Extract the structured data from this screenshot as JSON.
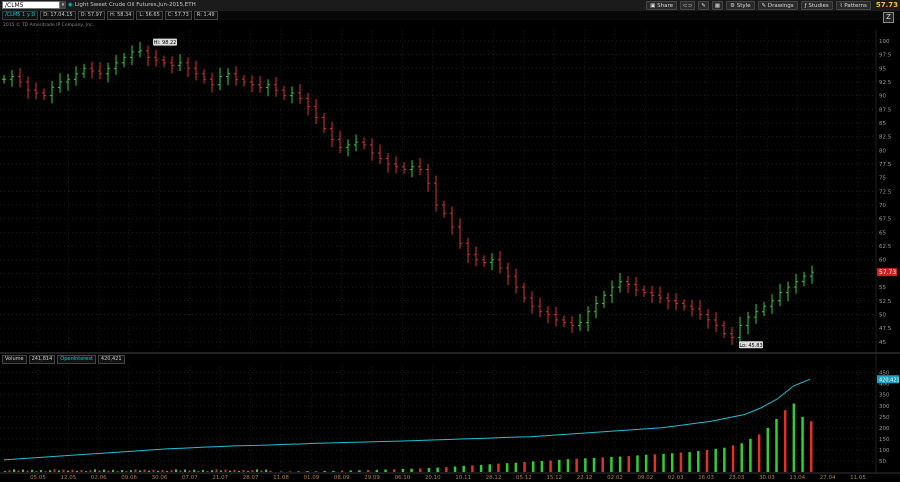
{
  "toolbar": {
    "symbol": "/CLM5",
    "description": "Light Sweet Crude Oil Futures,Jun-2015,ETH",
    "buttons": [
      "Share",
      "Style",
      "Drawings",
      "Studies",
      "Patterns"
    ],
    "last_price": "57.73"
  },
  "info_bar": {
    "symbol_period": "/CLM5 1 y D",
    "date": "D: 17.04.15",
    "open": "O: 57.97",
    "high": "H: 58.34",
    "low": "L: 56.65",
    "close": "C: 57.73",
    "change": "R: 1.49"
  },
  "copyright": "2015 © TD Ameritrade IP Company, Inc.",
  "volume_header": {
    "label": "Volume",
    "volume_value": "241,814",
    "oi_label": "OpenInterest",
    "oi_value": "420,421"
  },
  "chart_data": [
    {
      "type": "candlestick",
      "title": "Light Sweet Crude Oil Futures,Jun-2015,ETH",
      "ylim": [
        43.5,
        102
      ],
      "yticks": [
        45,
        47.5,
        50,
        52.5,
        55,
        57.5,
        60,
        62.5,
        65,
        67.5,
        70,
        72.5,
        75,
        77.5,
        80,
        82.5,
        85,
        87.5,
        90,
        92.5,
        95,
        97.5,
        100
      ],
      "price_marker": "57.73",
      "annotations": [
        {
          "text": "Hi: 98.22",
          "x": "30.06",
          "y": 98.22
        },
        {
          "text": "Lo: 45.83",
          "x": "18.03",
          "y": 45.83
        }
      ],
      "x_ticks": [
        "05.05",
        "12.05",
        "02.06",
        "09.06",
        "30.06",
        "07.07",
        "21.07",
        "28.07",
        "11.08",
        "01.09",
        "08.09",
        "29.09",
        "06.10",
        "20.10",
        "10.11",
        "28.12",
        "05.12",
        "15.12",
        "22.12",
        "02.02",
        "09.02",
        "02.03",
        "16.03",
        "23.03",
        "30.03",
        "13.04",
        "27.04",
        "11.05"
      ],
      "close_series": [
        93.0,
        93.5,
        92.5,
        91.0,
        90.5,
        90.0,
        91.5,
        92.5,
        93.0,
        94.0,
        95.0,
        94.5,
        94.0,
        95.0,
        96.0,
        97.0,
        98.0,
        98.2,
        97.0,
        96.5,
        96.0,
        95.5,
        96.0,
        95.0,
        94.0,
        93.0,
        92.0,
        93.5,
        94.0,
        93.0,
        92.5,
        92.0,
        91.5,
        92.0,
        91.0,
        90.0,
        90.5,
        89.5,
        88.0,
        86.0,
        84.0,
        82.0,
        80.5,
        81.0,
        81.5,
        81.0,
        79.5,
        78.5,
        77.5,
        77.0,
        76.5,
        77.0,
        76.5,
        74.0,
        70.0,
        68.5,
        66.0,
        63.0,
        61.0,
        60.0,
        59.5,
        60.0,
        58.5,
        57.0,
        55.0,
        53.0,
        51.5,
        50.5,
        50.0,
        49.0,
        48.5,
        48.0,
        48.5,
        50.5,
        52.0,
        53.5,
        55.0,
        56.0,
        55.5,
        54.5,
        54.0,
        53.5,
        53.0,
        52.5,
        52.0,
        51.5,
        51.0,
        50.0,
        49.0,
        48.0,
        46.5,
        45.8,
        48.0,
        49.5,
        50.5,
        51.5,
        52.5,
        54.0,
        55.0,
        56.0,
        57.0,
        57.73
      ]
    },
    {
      "type": "bar+line",
      "title": "Volume",
      "ylim": [
        0,
        480
      ],
      "yticks": [
        50,
        100,
        150,
        200,
        250,
        300,
        350,
        400,
        450
      ],
      "series": [
        {
          "name": "Volume",
          "values": [
            2,
            3,
            3,
            4,
            4,
            5,
            5,
            6,
            7,
            8,
            9,
            10,
            11,
            12,
            14,
            15,
            16,
            18,
            20,
            22,
            25,
            28,
            30,
            32,
            35,
            38,
            40,
            42,
            45,
            48,
            50,
            52,
            55,
            58,
            60,
            62,
            64,
            66,
            68,
            70,
            72,
            75,
            78,
            80,
            82,
            85,
            88,
            90,
            95,
            100,
            105,
            110,
            120,
            130,
            150,
            170,
            200,
            240,
            280,
            310,
            250,
            230
          ]
        },
        {
          "name": "OpenInterest",
          "values": [
            55,
            60,
            65,
            70,
            75,
            80,
            85,
            90,
            95,
            100,
            105,
            108,
            112,
            115,
            118,
            120,
            122,
            125,
            127,
            130,
            132,
            134,
            136,
            138,
            140,
            142,
            145,
            147,
            150,
            152,
            155,
            158,
            160,
            165,
            170,
            175,
            180,
            185,
            190,
            195,
            200,
            210,
            220,
            230,
            245,
            260,
            290,
            330,
            390,
            420
          ]
        }
      ],
      "value_marker": "420,421"
    }
  ]
}
